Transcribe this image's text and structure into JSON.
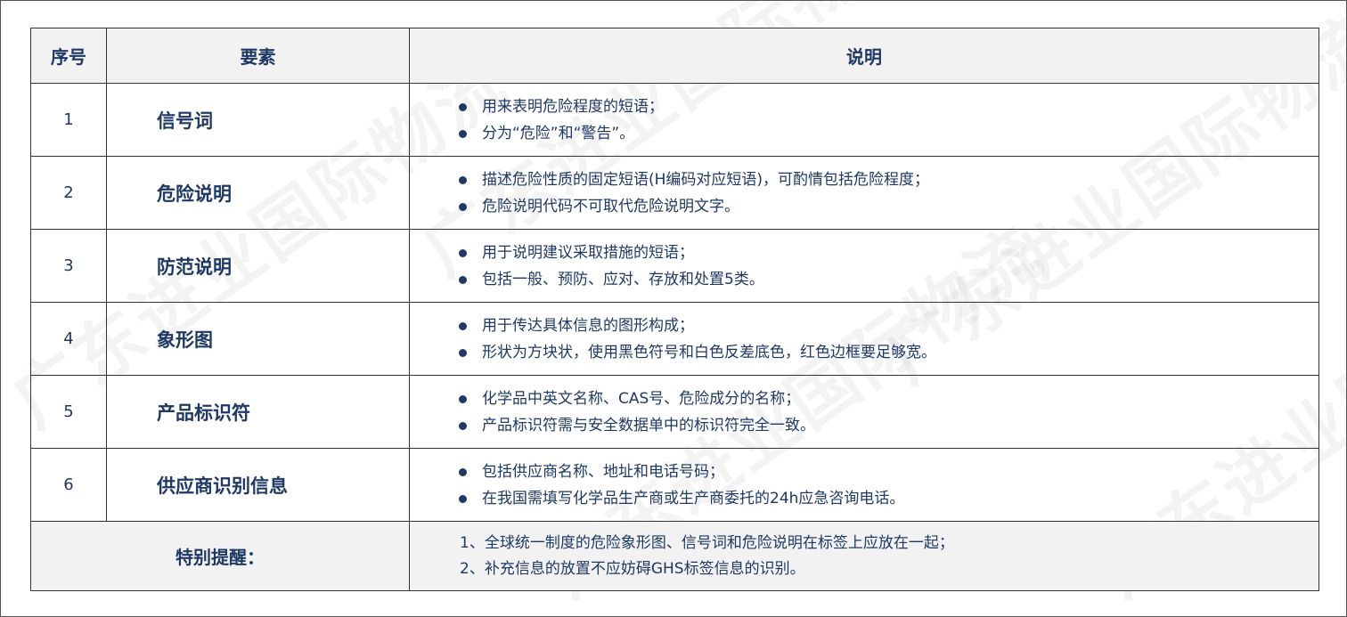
{
  "watermark": "广东进业国际物流",
  "table": {
    "headers": [
      "序号",
      "要素",
      "说明"
    ],
    "rows": [
      {
        "num": "1",
        "element": "信号词",
        "desc": [
          "用来表明危险程度的短语；",
          "分为“危险”和“警告”。"
        ]
      },
      {
        "num": "2",
        "element": "危险说明",
        "desc": [
          "描述危险性质的固定短语(H编码对应短语)，可酌情包括危险程度；",
          "危险说明代码不可取代危险说明文字。"
        ]
      },
      {
        "num": "3",
        "element": "防范说明",
        "desc": [
          "用于说明建议采取措施的短语；",
          "包括一般、预防、应对、存放和处置5类。"
        ]
      },
      {
        "num": "4",
        "element": "象形图",
        "desc": [
          "用于传达具体信息的图形构成；",
          "形状为方块状，使用黑色符号和白色反差底色，红色边框要足够宽。"
        ]
      },
      {
        "num": "5",
        "element": "产品标识符",
        "desc": [
          "化学品中英文名称、CAS号、危险成分的名称；",
          "产品标识符需与安全数据单中的标识符完全一致。"
        ]
      },
      {
        "num": "6",
        "element": "供应商识别信息",
        "desc": [
          "包括供应商名称、地址和电话号码；",
          "在我国需填写化学品生产商或生产商委托的24h应急咨询电话。"
        ]
      }
    ],
    "note": {
      "label": "特别提醒：",
      "lines": [
        "1、全球统一制度的危险象形图、信号词和危险说明在标签上应放在一起；",
        "2、补充信息的放置不应妨碍GHS标签信息的识别。"
      ]
    }
  },
  "colors": {
    "text": "#1f3864",
    "header_bg": "#f2f2f2",
    "border": "#333333"
  }
}
